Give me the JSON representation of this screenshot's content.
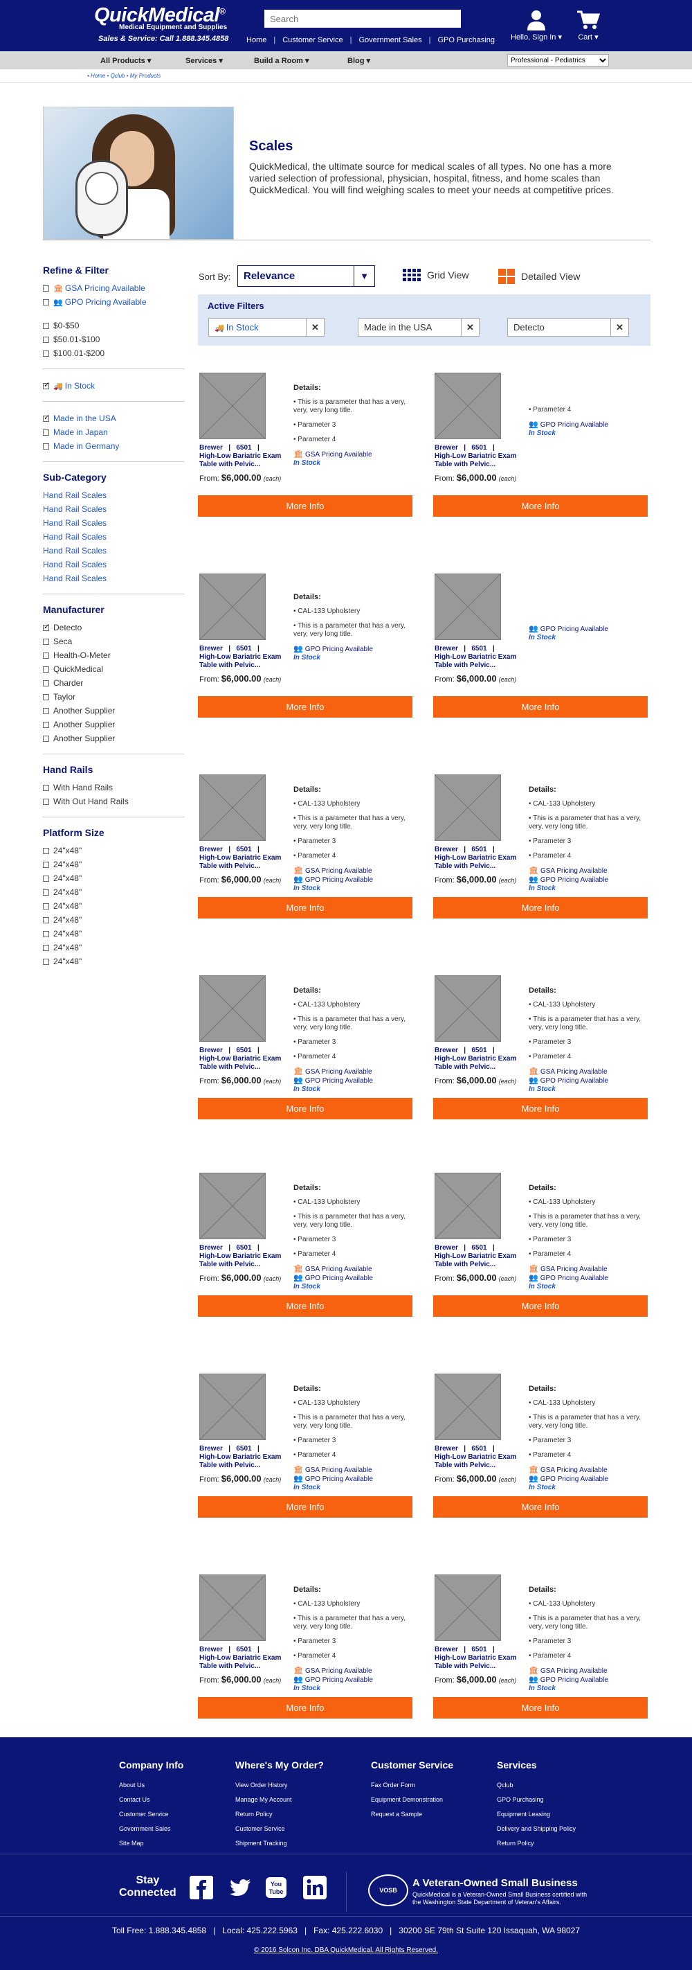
{
  "header": {
    "logo": "QuickMedical",
    "logo_mark": "®",
    "tagline": "Medical Equipment and Supplies",
    "phone": "Sales & Service: Call 1.888.345.4858",
    "search_placeholder": "Search",
    "links": [
      "Home",
      "Customer Service",
      "Government Sales",
      "GPO Purchasing"
    ],
    "account": "Hello, Sign In",
    "cart": "Cart"
  },
  "nav": {
    "items": [
      "All Products",
      "Services",
      "Build a Room",
      "Blog"
    ],
    "select_value": "Professional - Pediatrics"
  },
  "breadcrumb": "• Home • Qclub • My Products",
  "page": {
    "title": "Scales",
    "intro": "QuickMedical, the ultimate source for medical scales of all types. No one has a more varied selection of professional, physician, hospital, fitness, and home scales than QuickMedical. You will find weighing scales to meet your needs at competitive prices."
  },
  "sidebar": {
    "title": "Refine & Filter",
    "pricing": [
      "GSA Pricing Available",
      "GPO Pricing Available"
    ],
    "price_ranges": [
      "$0-$50",
      "$50.01-$100",
      "$100.01-$200"
    ],
    "stock": "In Stock",
    "origin": [
      "Made in the USA",
      "Made in Japan",
      "Made in Germany"
    ],
    "subcat_title": "Sub-Category",
    "subcats": [
      "Hand Rail Scales",
      "Hand Rail Scales",
      "Hand Rail Scales",
      "Hand Rail Scales",
      "Hand Rail Scales",
      "Hand Rail Scales",
      "Hand Rail Scales"
    ],
    "mfr_title": "Manufacturer",
    "mfrs": [
      "Detecto",
      "Seca",
      "Health-O-Meter",
      "QuickMedical",
      "Charder",
      "Taylor",
      "Another Supplier",
      "Another Supplier",
      "Another Supplier"
    ],
    "rails_title": "Hand Rails",
    "rails": [
      "With Hand Rails",
      "With Out Hand Rails"
    ],
    "platform_title": "Platform Size",
    "platforms": [
      "24\"x48\"",
      "24\"x48\"",
      "24\"x48\"",
      "24\"x48\"",
      "24\"x48\"",
      "24\"x48\"",
      "24\"x48\"",
      "24\"x48\"",
      "24\"x48\""
    ]
  },
  "sort": {
    "label": "Sort By:",
    "value": "Relevance",
    "grid_view": "Grid View",
    "detail_view": "Detailed View"
  },
  "active_filters": {
    "label": "Active Filters",
    "chips": [
      "In Stock",
      "Made in the USA",
      "Detecto"
    ]
  },
  "product": {
    "name_line1": "Brewer   |   6501   |",
    "name_line2": "High-Low Bariatric Exam",
    "name_line3": "Table with Pelvic...",
    "price_from": "From:",
    "price": "$6,000.00",
    "price_unit": "(each)",
    "details_label": "Details:",
    "upholstery": "• CAL-133 Upholstery",
    "long_param": "• This is a parameter that has a very, very, very long title.",
    "param3": "• Parameter 3",
    "param4": "• Parameter 4",
    "gsa": "GSA Pricing Available",
    "gpo": "GPO Pricing Available",
    "stock": "In Stock",
    "button": "More Info"
  },
  "footer": {
    "cols": [
      {
        "title": "Company Info",
        "links": [
          "About Us",
          "Contact Us",
          "Customer Service",
          "Government Sales",
          "Site Map"
        ]
      },
      {
        "title": "Where's My Order?",
        "links": [
          "View Order History",
          "Manage My Account",
          "Return Policy",
          "Customer Service",
          "Shipment Tracking"
        ]
      },
      {
        "title": "Customer Service",
        "links": [
          "Fax Order Form",
          "Equipment Demonstration",
          "Request a Sample"
        ]
      },
      {
        "title": "Services",
        "links": [
          "Qclub",
          "GPO Purchasing",
          "Equipment Leasing",
          "Delivery and Shipping Policy",
          "Return Policy"
        ]
      }
    ],
    "stay": "Stay",
    "connected": "Connected",
    "vosb_badge": "VOSB",
    "vosb_title": "A Veteran-Owned Small Business",
    "vosb_desc": "QuickMedical is a Veteran-Owned Small Business certified with the Washington State Department of Veteran's Affairs.",
    "contact": "Toll Free: 1.888.345.4858   |   Local: 425.222.5963   |   Fax: 425.222.6030   |   30200 SE 79th St Suite 120 Issaquah, WA 98027",
    "copyright": "© 2016 Solcon Inc. DBA QuickMedical. All Rights Reserved."
  }
}
